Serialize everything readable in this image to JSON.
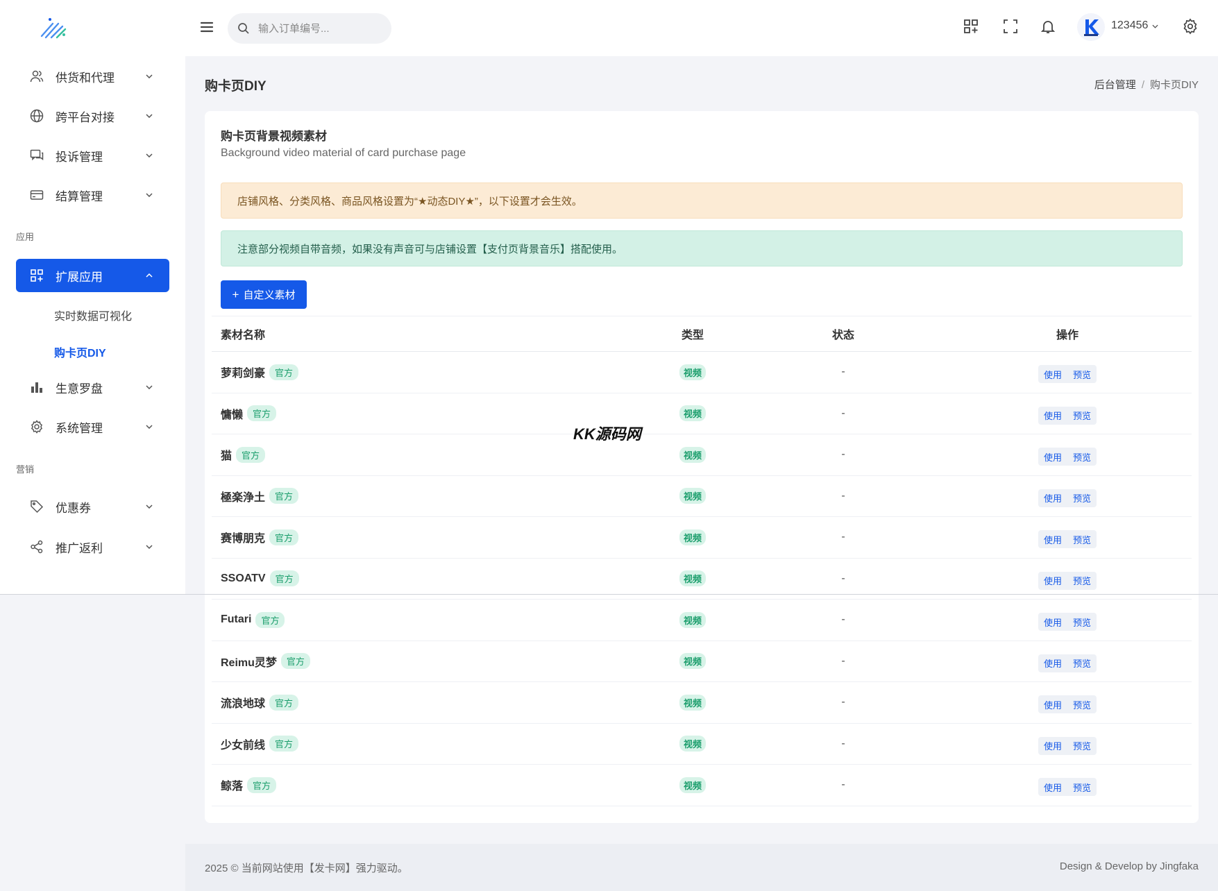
{
  "topbar": {
    "search_placeholder": "输入订单编号...",
    "username": "123456"
  },
  "sidebar": {
    "items_top": [
      {
        "label": "供货和代理",
        "icon": "user-icon"
      },
      {
        "label": "跨平台对接",
        "icon": "globe-icon"
      },
      {
        "label": "投诉管理",
        "icon": "chat-icon"
      },
      {
        "label": "结算管理",
        "icon": "card-icon"
      }
    ],
    "section_apps": "应用",
    "active_item": {
      "label": "扩展应用",
      "icon": "apps-icon"
    },
    "sub_items": [
      "实时数据可视化",
      "购卡页DIY"
    ],
    "items_mid": [
      {
        "label": "生意罗盘",
        "icon": "bar-chart-icon"
      },
      {
        "label": "系统管理",
        "icon": "gear-icon"
      }
    ],
    "section_marketing": "营销",
    "items_bottom": [
      {
        "label": "优惠券",
        "icon": "tag-icon"
      },
      {
        "label": "推广返利",
        "icon": "share-icon"
      }
    ]
  },
  "page": {
    "title": "购卡页DIY",
    "breadcrumb": [
      "后台管理",
      "/",
      "购卡页DIY"
    ]
  },
  "card": {
    "title": "购卡页背景视频素材",
    "subtitle": "Background video material of card purchase page",
    "alert_warn": "店铺风格、分类风格、商品风格设置为“★动态DIY★”，以下设置才会生效。",
    "alert_info": "注意部分视频自带音频，如果没有声音可与店铺设置【支付页背景音乐】搭配使用。",
    "add_button": "自定义素材",
    "add_plus": "+"
  },
  "table": {
    "headers": [
      "素材名称",
      "类型",
      "状态",
      "操作"
    ],
    "official_tag": "官方",
    "type_tag": "视频",
    "status_value": "-",
    "action_use": "使用",
    "action_preview": "预览",
    "rows": [
      {
        "name": "萝莉剑豪"
      },
      {
        "name": "慵懒"
      },
      {
        "name": "猫"
      },
      {
        "name": "極楽浄土"
      },
      {
        "name": "赛博朋克"
      },
      {
        "name": "SSOATV"
      },
      {
        "name": "Futari"
      },
      {
        "name": "Reimu灵梦"
      },
      {
        "name": "流浪地球"
      },
      {
        "name": "少女前线"
      },
      {
        "name": "鲸落"
      }
    ]
  },
  "watermark": "KK源码网",
  "footer": {
    "left": "2025 © 当前网站使用【发卡网】强力驱动。",
    "right": "Design & Develop by Jingfaka"
  },
  "colors": {
    "primary": "#1559e8",
    "success_tag_bg": "#d7f3e8",
    "success_tag_text": "#1b9e6c",
    "warn_bg": "#fcebd5",
    "info_bg": "#d3f1e6"
  }
}
